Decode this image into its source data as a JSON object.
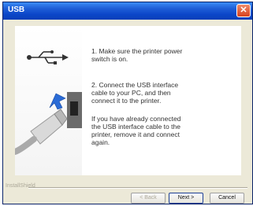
{
  "window": {
    "title": "USB",
    "close_glyph": "✕"
  },
  "messages": {
    "step1": "1. Make sure the printer power\nswitch is on.",
    "step2": "2. Connect the USB interface\ncable to your PC, and then\nconnect it to the printer.",
    "step3": "If you have already connected\nthe USB interface cable to the\nprinter, remove it and connect\nagain."
  },
  "footer": {
    "group_label": "InstallShield",
    "back_label": "< Back",
    "next_label": "Next >",
    "cancel_label": "Cancel"
  },
  "icons": [
    "usb-symbol-icon",
    "usb-cable-illustration",
    "close-icon"
  ],
  "colors": {
    "titlebar": "#0b46c8",
    "dialog": "#ece9d8",
    "usb_arrow": "#2a6bd6"
  }
}
